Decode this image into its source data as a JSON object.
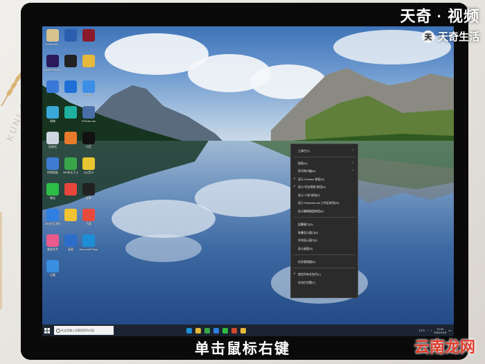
{
  "watermark": {
    "brand": "天奇 · 视频",
    "sub": "天奇生活",
    "logo": "天"
  },
  "background": {
    "text": "KUNI OSO"
  },
  "desktop": {
    "icons": [
      {
        "label": "Adobeexo..",
        "color": "#d6c38e",
        "name": "folder-icon"
      },
      {
        "label": "",
        "color": "#2a5fb0",
        "name": "maxthon-icon"
      },
      {
        "label": "",
        "color": "#8a1a2a",
        "name": "app-red-icon"
      },
      {
        "label": "Adobe Premie..",
        "color": "#2a1a5a",
        "name": "premiere-icon"
      },
      {
        "label": "",
        "color": "#222",
        "name": "qq-icon"
      },
      {
        "label": "",
        "color": "#e6b93c",
        "name": "folder2-icon"
      },
      {
        "label": "",
        "color": "#3a78d8",
        "name": "this-pc-icon"
      },
      {
        "label": "",
        "color": "#1f6fd6",
        "name": "app-blue-icon"
      },
      {
        "label": "钉钉",
        "color": "#3c8ee6",
        "name": "dingtalk-icon"
      },
      {
        "label": "网络",
        "color": "#3aa7d8",
        "name": "network-icon"
      },
      {
        "label": "",
        "color": "#1fb0a0",
        "name": "green-icon"
      },
      {
        "label": "IDScan.car",
        "color": "#4a6ea8",
        "name": "idscan-icon"
      },
      {
        "label": "回收站",
        "color": "#ccd6e0",
        "name": "recycle-bin-icon"
      },
      {
        "label": "",
        "color": "#e87a2c",
        "name": "tool-icon"
      },
      {
        "label": "抖音",
        "color": "#111",
        "name": "douyin-icon"
      },
      {
        "label": "控制面板",
        "color": "#3f7bd3",
        "name": "control-panel-icon"
      },
      {
        "label": "360安全卫士",
        "color": "#3aa64a",
        "name": "360-safe-icon"
      },
      {
        "label": "QQ音乐",
        "color": "#e9c531",
        "name": "qqmusic-icon"
      },
      {
        "label": "微信",
        "color": "#2dbd46",
        "name": "wechat-icon"
      },
      {
        "label": "",
        "color": "#e8453c",
        "name": "color-icon"
      },
      {
        "label": "剪映",
        "color": "#222",
        "name": "jianying-icon"
      },
      {
        "label": "360安全浏览",
        "color": "#2f7fe0",
        "name": "360-browser-icon"
      },
      {
        "label": "",
        "color": "#f1c232",
        "name": "yellow-icon"
      },
      {
        "label": "百度",
        "color": "#e84a3c",
        "name": "baidu-icon"
      },
      {
        "label": "美图秀秀",
        "color": "#e95b8a",
        "name": "meitu-icon"
      },
      {
        "label": "画图",
        "color": "#2b6dc8",
        "name": "paint-icon"
      },
      {
        "label": "Microsoft Edge",
        "color": "#1c8fd6",
        "name": "edge-icon"
      },
      {
        "label": "迅雷",
        "color": "#3a8fe0",
        "name": "xunlei-icon"
      }
    ]
  },
  "taskbar": {
    "search_placeholder": "在这里输入你要搜索的内容",
    "weather": "14°C",
    "time": "13:40",
    "date": "2022/1/16"
  },
  "context_menu": {
    "items": [
      {
        "label": "工具栏(T)",
        "arrow": true,
        "check": false
      },
      {
        "label": "搜索(H)",
        "arrow": true,
        "check": false
      },
      {
        "label": "资讯和兴趣(N)",
        "arrow": true,
        "check": false
      },
      {
        "label": "显示 Cortana 按钮(O)",
        "arrow": false,
        "check": true
      },
      {
        "label": "显示\"任务视图\"按钮(V)",
        "arrow": false,
        "check": true
      },
      {
        "label": "显示\"人脉\"按钮(P)",
        "arrow": false,
        "check": false
      },
      {
        "label": "显示 Windows Ink 工作区按钮(W)",
        "arrow": false,
        "check": false
      },
      {
        "label": "显示触摸键盘按钮(K)",
        "arrow": false,
        "check": false
      },
      {
        "label": "层叠窗口(D)",
        "arrow": false,
        "check": false
      },
      {
        "label": "堆叠显示窗口(E)",
        "arrow": false,
        "check": false
      },
      {
        "label": "并排显示窗口(I)",
        "arrow": false,
        "check": false
      },
      {
        "label": "显示桌面(S)",
        "arrow": false,
        "check": false
      },
      {
        "label": "任务管理器(K)",
        "arrow": false,
        "check": false
      },
      {
        "label": "锁定所有任务栏(L)",
        "arrow": false,
        "check": true
      },
      {
        "label": "任务栏设置(T)",
        "arrow": false,
        "check": false
      }
    ]
  },
  "caption": "单击鼠标右键",
  "site_watermark": "云南龙网"
}
